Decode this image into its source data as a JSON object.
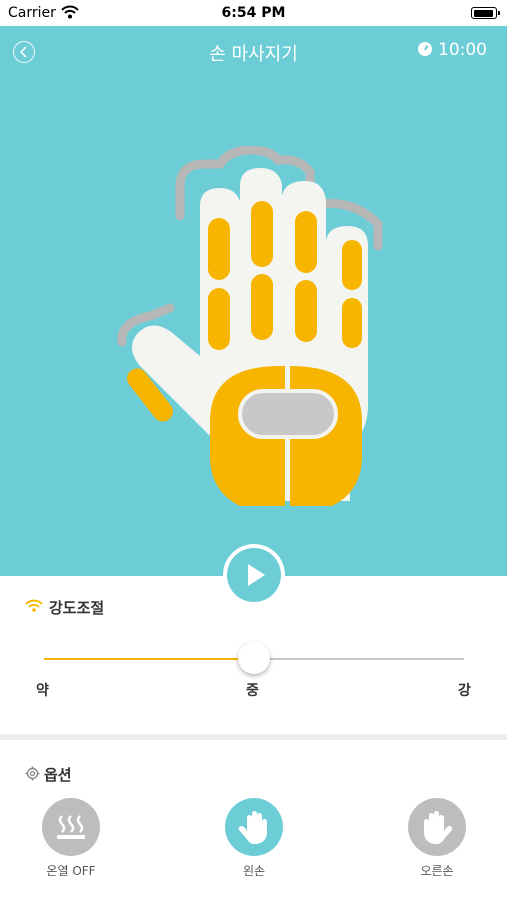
{
  "status_bar": {
    "carrier": "Carrier",
    "time": "6:54 PM"
  },
  "header": {
    "title": "손 마사지기",
    "timer": "10:00"
  },
  "intensity": {
    "label": "강도조절",
    "ticks": [
      "약",
      "중",
      "강"
    ],
    "level": 0.5
  },
  "options": {
    "label": "옵션",
    "items": [
      {
        "label": "온열 OFF",
        "icon": "heat-icon",
        "active": false
      },
      {
        "label": "왼손",
        "icon": "left-hand-icon",
        "active": true
      },
      {
        "label": "오른손",
        "icon": "right-hand-icon",
        "active": false
      }
    ]
  },
  "colors": {
    "accent": "#6dcdd7",
    "highlight": "#f7b500",
    "inactive": "#bdbdbd"
  }
}
